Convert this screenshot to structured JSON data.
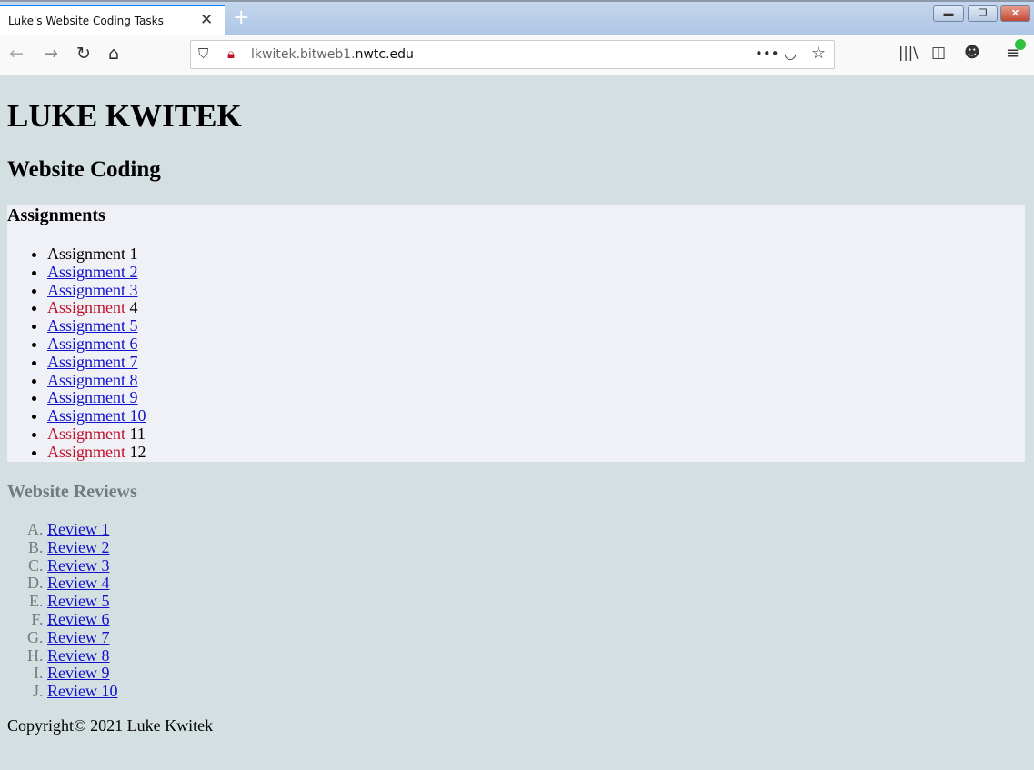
{
  "browser": {
    "tab_title": "Luke's Website Coding Tasks",
    "url_prefix": "lkwitek.bitweb1.",
    "url_domain": "nwtc.edu"
  },
  "page": {
    "name": "LUKE KWITEK",
    "subtitle": "Website Coding",
    "assignments": {
      "heading": "Assignments",
      "items": [
        {
          "word": "Assignment",
          "num": "1",
          "state": "plain"
        },
        {
          "word": "Assignment",
          "num": "2",
          "state": "link"
        },
        {
          "word": "Assignment",
          "num": "3",
          "state": "link"
        },
        {
          "word": "Assignment",
          "num": "4",
          "state": "red"
        },
        {
          "word": "Assignment",
          "num": "5",
          "state": "link"
        },
        {
          "word": "Assignment",
          "num": "6",
          "state": "link"
        },
        {
          "word": "Assignment",
          "num": "7",
          "state": "link"
        },
        {
          "word": "Assignment",
          "num": "8",
          "state": "link"
        },
        {
          "word": "Assignment",
          "num": "9",
          "state": "link"
        },
        {
          "word": "Assignment",
          "num": "10",
          "state": "link"
        },
        {
          "word": "Assignment",
          "num": "11",
          "state": "red"
        },
        {
          "word": "Assignment",
          "num": "12",
          "state": "red"
        }
      ]
    },
    "reviews": {
      "heading": "Website Reviews",
      "items": [
        "Review 1",
        "Review 2",
        "Review 3",
        "Review 4",
        "Review 5",
        "Review 6",
        "Review 7",
        "Review 8",
        "Review 9",
        "Review 10"
      ]
    },
    "copyright": "Copyright© 2021 Luke Kwitek"
  },
  "colors": {
    "link": "#1111cc",
    "red": "#c0112a",
    "background": "#d4dfe1",
    "section": "#f0f1f6",
    "muted": "#6f7d7f"
  }
}
